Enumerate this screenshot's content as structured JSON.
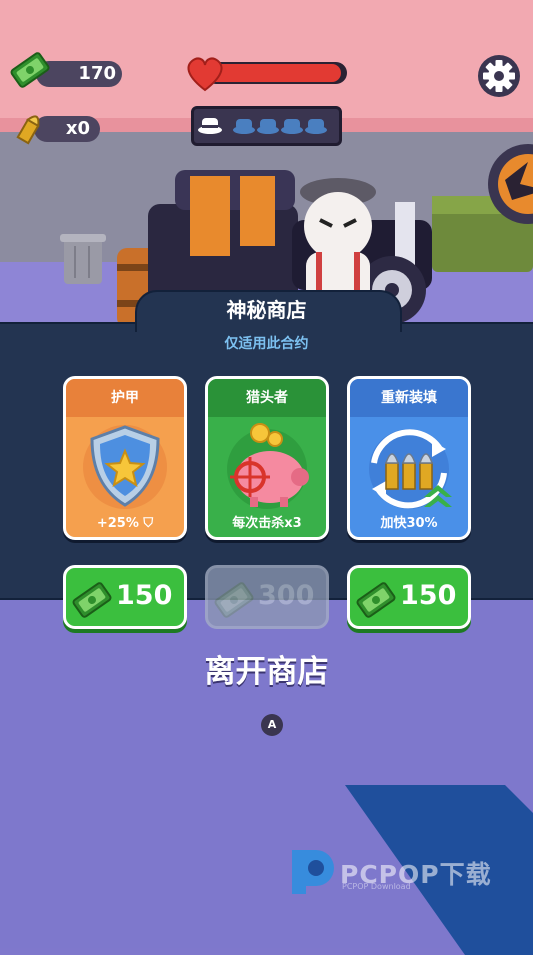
{
  "hud": {
    "cash": "170",
    "ammo": "x0",
    "health_fraction": 0.97,
    "wanted_level": 0,
    "wanted_max": 4
  },
  "shop": {
    "title": "神秘商店",
    "subtitle": "仅适用此合约",
    "items": [
      {
        "name": "护甲",
        "effect": "+25%",
        "price": "150",
        "color": "#f5a04e",
        "head_color": "#e8813a",
        "icon": "shield-icon",
        "available": true
      },
      {
        "name": "猎头者",
        "effect": "每次击杀x3",
        "price": "300",
        "color": "#39b04a",
        "head_color": "#2a9238",
        "icon": "piggy-bank-icon",
        "available": false
      },
      {
        "name": "重新装填",
        "effect": "加快30%",
        "price": "150",
        "color": "#4a90e8",
        "head_color": "#3a76cf",
        "icon": "bullets-reload-icon",
        "available": true
      }
    ],
    "leave_label": "离开商店",
    "leave_key": "A"
  },
  "watermark": {
    "text": "PCPOP下载",
    "sub": "PCPOP Download"
  },
  "colors": {
    "wall": "#f2a9b1",
    "panel": "#233451",
    "buy_green": "#3bbf3e",
    "ground": "#7e78cc"
  }
}
